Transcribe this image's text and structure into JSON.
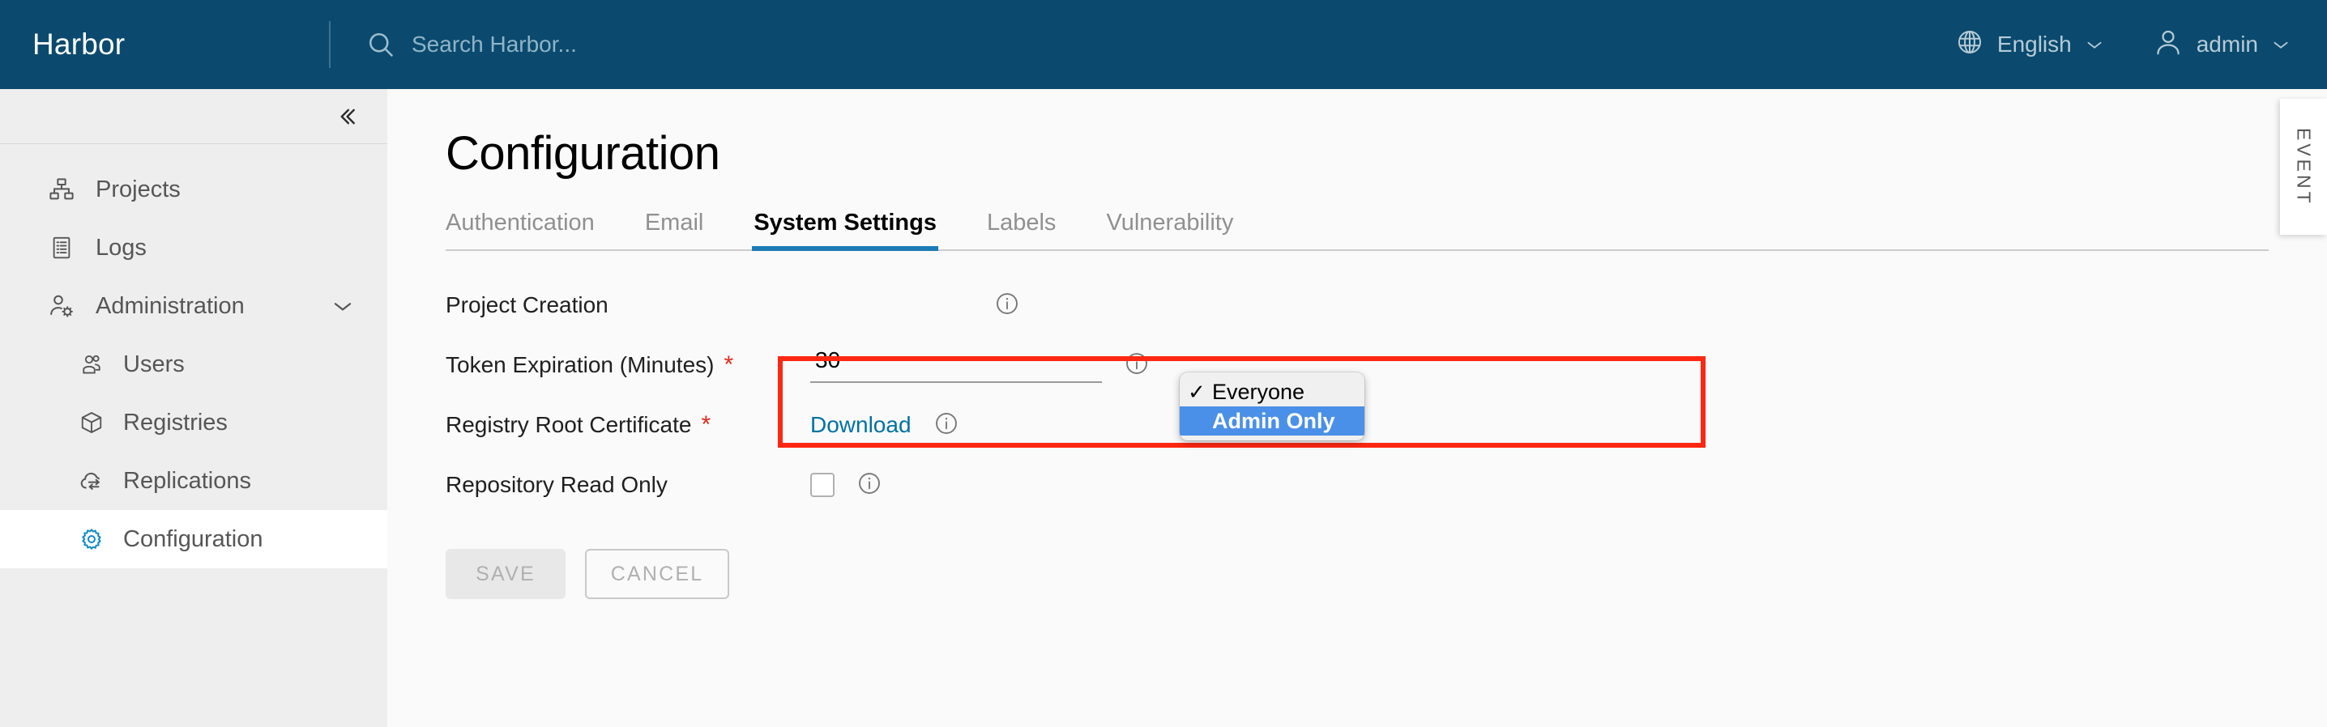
{
  "header": {
    "brand": "Harbor",
    "search": {
      "placeholder": "Search Harbor...",
      "value": "",
      "icon": "search-icon"
    },
    "language": {
      "label": "English",
      "icon": "globe-icon",
      "chevron": "chevron-down-icon"
    },
    "user": {
      "label": "admin",
      "icon": "user-icon",
      "chevron": "chevron-down-icon"
    },
    "bg_color": "#0b4a6e"
  },
  "sidebar": {
    "collapse_icon": "double-chevron-left-icon",
    "items": [
      {
        "label": "Projects",
        "icon": "projects-icon",
        "active": false,
        "sub": false
      },
      {
        "label": "Logs",
        "icon": "logs-icon",
        "active": false,
        "sub": false
      },
      {
        "label": "Administration",
        "icon": "administration-icon",
        "active": false,
        "sub": false,
        "expanded": true,
        "chevron": "chevron-down-icon"
      },
      {
        "label": "Users",
        "icon": "users-icon",
        "active": false,
        "sub": true
      },
      {
        "label": "Registries",
        "icon": "registry-box-icon",
        "active": false,
        "sub": true
      },
      {
        "label": "Replications",
        "icon": "replication-cloud-icon",
        "active": false,
        "sub": true
      },
      {
        "label": "Configuration",
        "icon": "gear-icon",
        "active": true,
        "sub": true
      }
    ]
  },
  "main": {
    "page_title": "Configuration",
    "tabs": [
      {
        "label": "Authentication",
        "active": false
      },
      {
        "label": "Email",
        "active": false
      },
      {
        "label": "System Settings",
        "active": true
      },
      {
        "label": "Labels",
        "active": false
      },
      {
        "label": "Vulnerability",
        "active": false
      }
    ],
    "active_tab_color": "#1c7cb5",
    "form": {
      "rows": [
        {
          "label": "Project Creation",
          "required": false,
          "control": "select",
          "value": "Everyone",
          "info": true
        },
        {
          "label": "Token Expiration (Minutes)",
          "required": true,
          "control": "text",
          "value": "30",
          "info": true
        },
        {
          "label": "Registry Root Certificate",
          "required": true,
          "control": "link",
          "value": "Download",
          "info": true
        },
        {
          "label": "Repository Read Only",
          "required": false,
          "control": "checkbox",
          "checked": false,
          "info": true
        }
      ],
      "required_marker": "*",
      "info_icon": "info-circle-icon"
    },
    "select_popup": {
      "options": [
        {
          "label": "Everyone",
          "checked": true,
          "highlighted": false
        },
        {
          "label": "Admin Only",
          "checked": false,
          "highlighted": true
        }
      ],
      "check_glyph": "✓",
      "highlight_color": "#4a90e8"
    },
    "highlight_box": {
      "color": "#fe2712"
    },
    "buttons": {
      "save": "SAVE",
      "cancel": "CANCEL"
    }
  },
  "event_panel": {
    "label": "EVENT"
  }
}
